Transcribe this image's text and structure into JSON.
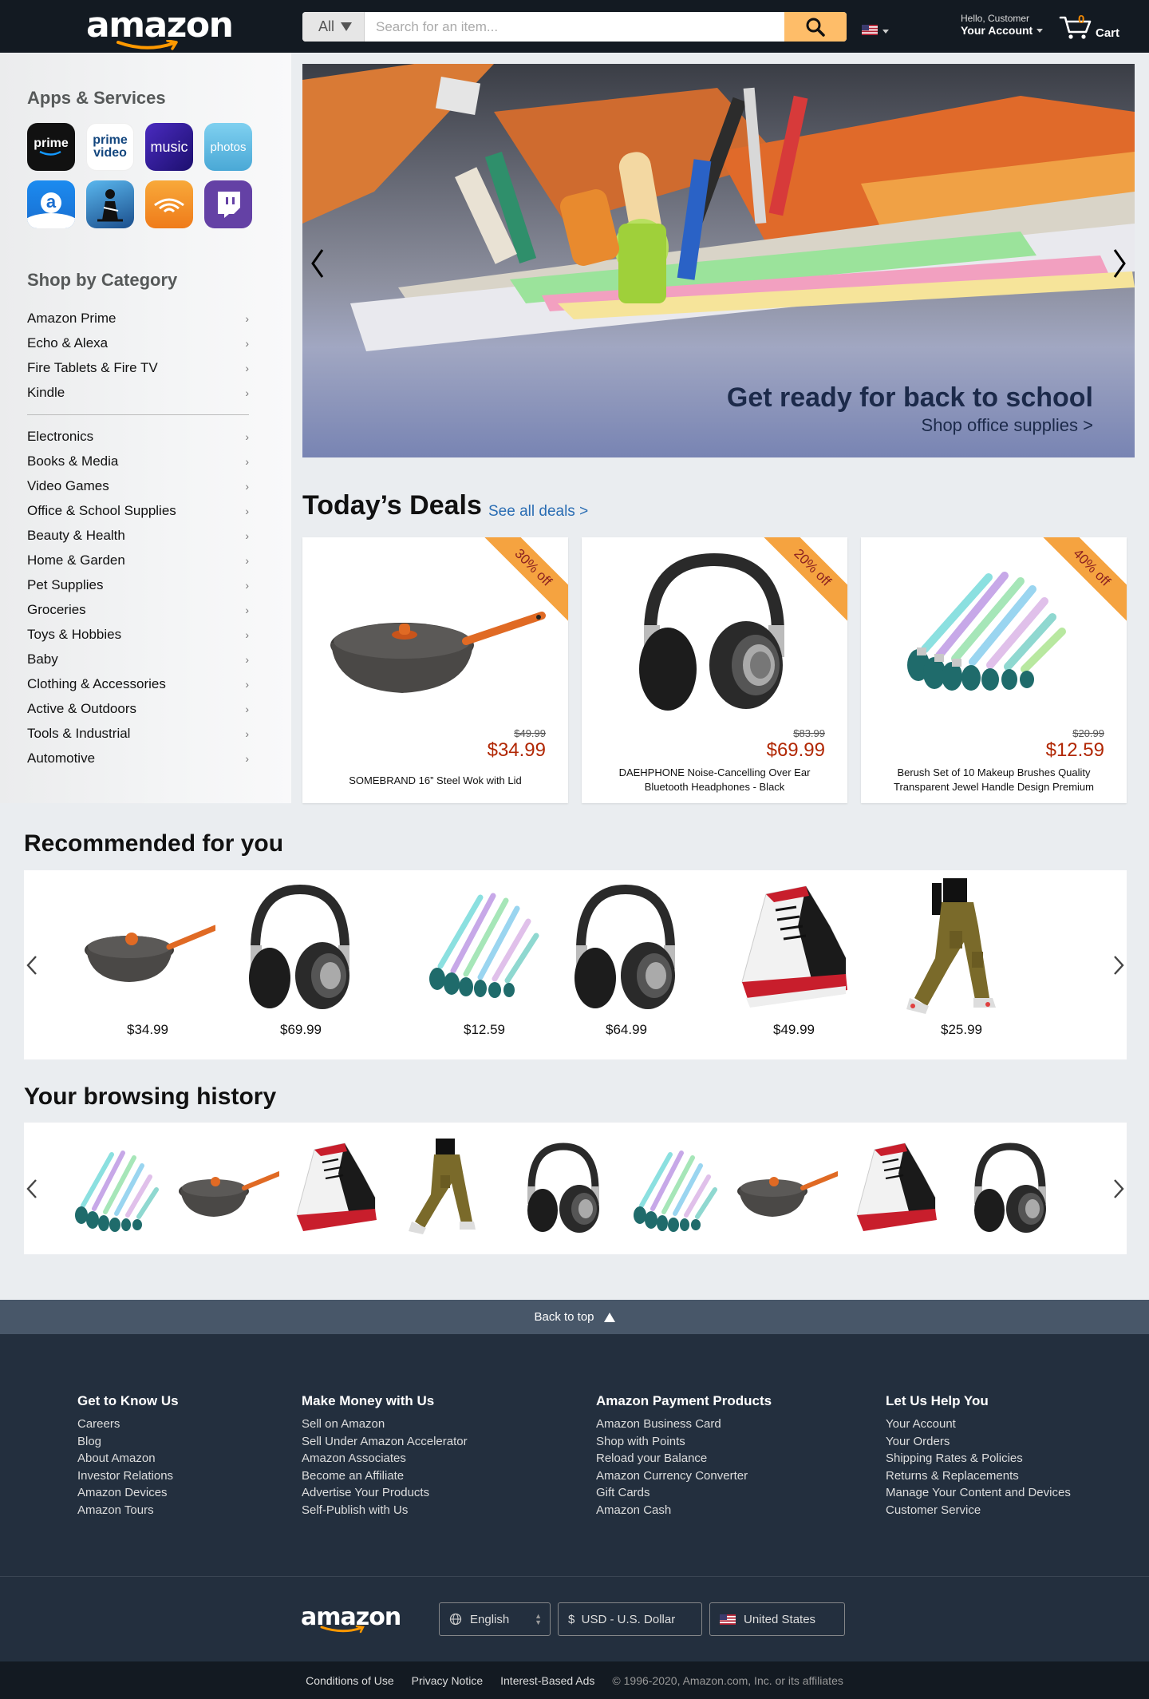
{
  "header": {
    "logo": "amazon",
    "search": {
      "category": "All",
      "placeholder": "Search for an item..."
    },
    "account": {
      "greeting": "Hello, Customer",
      "label": "Your Account"
    },
    "cart": {
      "count": "0",
      "label": "Cart"
    }
  },
  "sidebar": {
    "apps_title": "Apps & Services",
    "apps": [
      {
        "label": "prime",
        "color": "#111111"
      },
      {
        "label": "prime video",
        "color": "#ffffff"
      },
      {
        "label": "music",
        "color": "#3b1f93"
      },
      {
        "label": "photos",
        "color": "#5ab6e0"
      },
      {
        "label": "a",
        "color": "#1a8fe3"
      },
      {
        "label": "",
        "color": "#1e5a99"
      },
      {
        "label": "",
        "color": "#f29a2e"
      },
      {
        "label": "",
        "color": "#6441a5"
      }
    ],
    "category_title": "Shop by Category",
    "top_categories": [
      "Amazon Prime",
      "Echo & Alexa",
      "Fire Tablets & Fire TV",
      "Kindle"
    ],
    "categories": [
      "Electronics",
      "Books & Media",
      "Video Games",
      "Office & School Supplies",
      "Beauty & Health",
      "Home & Garden",
      "Pet Supplies",
      "Groceries",
      "Toys & Hobbies",
      "Baby",
      "Clothing & Accessories",
      "Active & Outdoors",
      "Tools & Industrial",
      "Automotive"
    ]
  },
  "hero": {
    "title": "Get ready for back to school",
    "subtitle": "Shop office supplies >"
  },
  "deals": {
    "title": "Today’s Deals",
    "link": "See all deals >",
    "items": [
      {
        "badge": "30% off",
        "old_price": "$49.99",
        "price": "$34.99",
        "name": "SOMEBRAND 16” Steel Wok with Lid"
      },
      {
        "badge": "20% off",
        "old_price": "$83.99",
        "price": "$69.99",
        "name": "DAEHPHONE Noise-Cancelling Over Ear Bluetooth Headphones - Black"
      },
      {
        "badge": "40% off",
        "old_price": "$20.99",
        "price": "$12.59",
        "name": "Berush Set of 10 Makeup Brushes Quality Transparent Jewel Handle Design Premium"
      }
    ]
  },
  "recommended": {
    "title": "Recommended for you",
    "prices": [
      "$34.99",
      "$69.99",
      "$12.59",
      "$64.99",
      "$49.99",
      "$25.99"
    ]
  },
  "history": {
    "title": "Your browsing history"
  },
  "footer": {
    "back_to_top": "Back to top",
    "columns": [
      {
        "title": "Get to Know Us",
        "links": [
          "Careers",
          "Blog",
          "About Amazon",
          "Investor Relations",
          "Amazon Devices",
          "Amazon Tours"
        ]
      },
      {
        "title": "Make Money with Us",
        "links": [
          "Sell on Amazon",
          "Sell Under Amazon Accelerator",
          "Amazon Associates",
          "Become an Affiliate",
          "Advertise Your Products",
          "Self-Publish with Us"
        ]
      },
      {
        "title": "Amazon Payment Products",
        "links": [
          "Amazon Business Card",
          "Shop with Points",
          "Reload your Balance",
          "Amazon Currency Converter",
          "Gift Cards",
          "Amazon Cash"
        ]
      },
      {
        "title": "Let Us Help You",
        "links": [
          "Your Account",
          "Your Orders",
          "Shipping Rates & Policies",
          "Returns & Replacements",
          "Manage Your Content and Devices",
          "Customer Service"
        ]
      }
    ],
    "logo": "amazon",
    "language": "English",
    "currency": "$  USD - U.S. Dollar",
    "country": "United States",
    "bottom_links": [
      "Conditions of Use",
      "Privacy Notice",
      "Interest-Based Ads"
    ],
    "copyright": "© 1996-2020, Amazon.com, Inc. or its affiliates"
  }
}
